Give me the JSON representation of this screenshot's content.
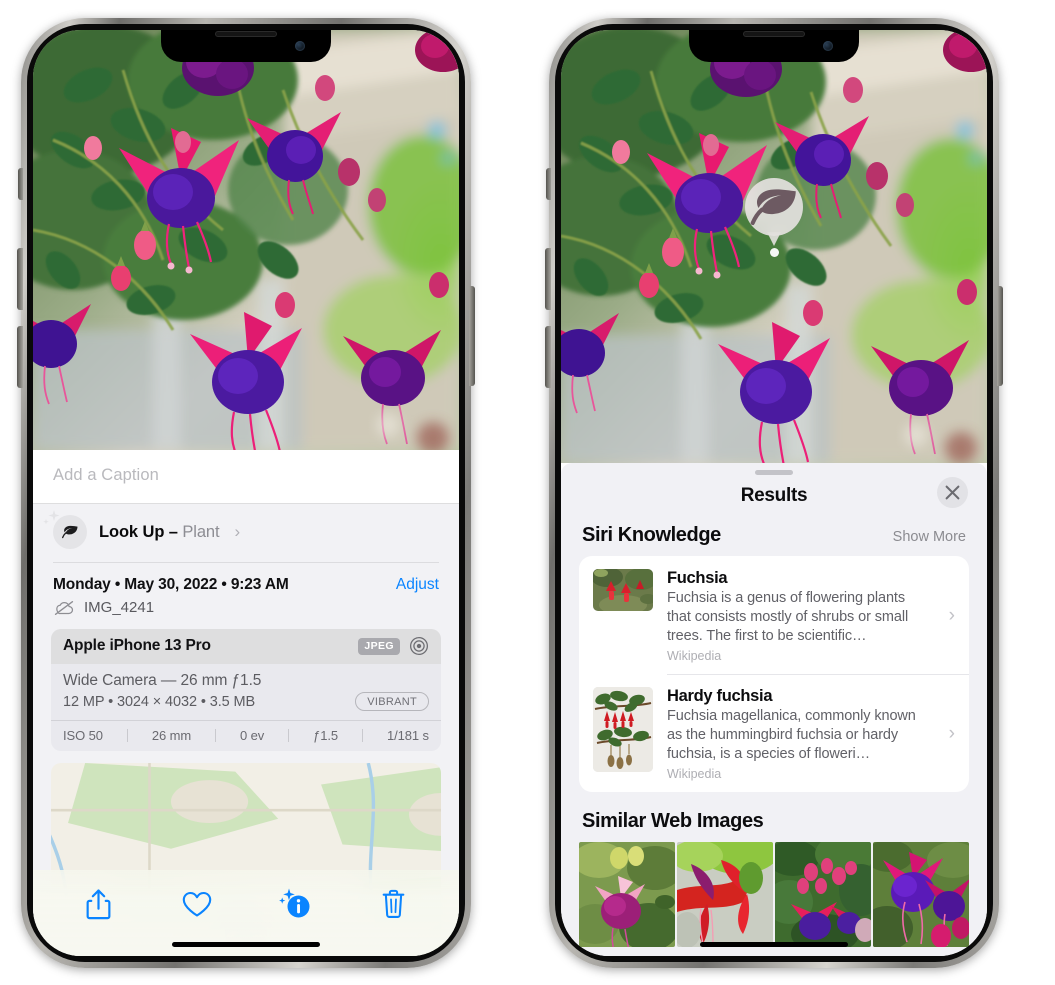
{
  "left_phone": {
    "photo": {
      "alt": "fuchsia-flowers-photo"
    },
    "caption": {
      "placeholder": "Add a Caption",
      "value": ""
    },
    "lookup": {
      "label": "Look Up – ",
      "subject": "Plant",
      "chevron": "›",
      "icon": "leaf-icon",
      "sparkle": "sparkle-icon"
    },
    "meta": {
      "date": "Monday • May 30, 2022 • 9:23 AM",
      "adjust": "Adjust",
      "filename": "IMG_4241",
      "cloud_icon": "icloud-slash-icon"
    },
    "camera": {
      "model": "Apple iPhone 13 Pro",
      "format_badge": "JPEG",
      "raw_icon": "aperture-icon",
      "lens_line": "Wide Camera — 26 mm ƒ1.5",
      "size_line": "12 MP • 3024 × 4032 • 3.5 MB",
      "style_badge": "VIBRANT",
      "exif": [
        "ISO 50",
        "26 mm",
        "0 ev",
        "ƒ1.5",
        "1/181 s"
      ]
    },
    "toolbar": [
      {
        "name": "share-button",
        "icon": "share-icon"
      },
      {
        "name": "favorite-button",
        "icon": "heart-icon"
      },
      {
        "name": "info-button",
        "icon": "info-sparkle-icon"
      },
      {
        "name": "delete-button",
        "icon": "trash-icon"
      }
    ],
    "accent_color": "#0a84ff"
  },
  "right_phone": {
    "photo": {
      "alt": "fuchsia-flowers-photo"
    },
    "visual_lookup_badge": {
      "icon": "leaf-icon"
    },
    "sheet": {
      "title": "Results",
      "close_icon": "close-icon",
      "sections": [
        {
          "title": "Siri Knowledge",
          "action": "Show More",
          "items": [
            {
              "title": "Fuchsia",
              "description": "Fuchsia is a genus of flowering plants that consists mostly of shrubs or small trees. The first to be scientific…",
              "source": "Wikipedia",
              "chevron": "›",
              "thumb": "fuchsia-red-flowers-thumb"
            },
            {
              "title": "Hardy fuchsia",
              "description": "Fuchsia magellanica, commonly known as the hummingbird fuchsia or hardy fuchsia, is a species of floweri…",
              "source": "Wikipedia",
              "chevron": "›",
              "thumb": "hardy-fuchsia-branch-thumb"
            }
          ]
        },
        {
          "title": "Similar Web Images",
          "images": [
            "fuchsia-web-image-1",
            "fuchsia-web-image-2",
            "fuchsia-web-image-3",
            "fuchsia-web-image-4"
          ]
        }
      ]
    }
  }
}
